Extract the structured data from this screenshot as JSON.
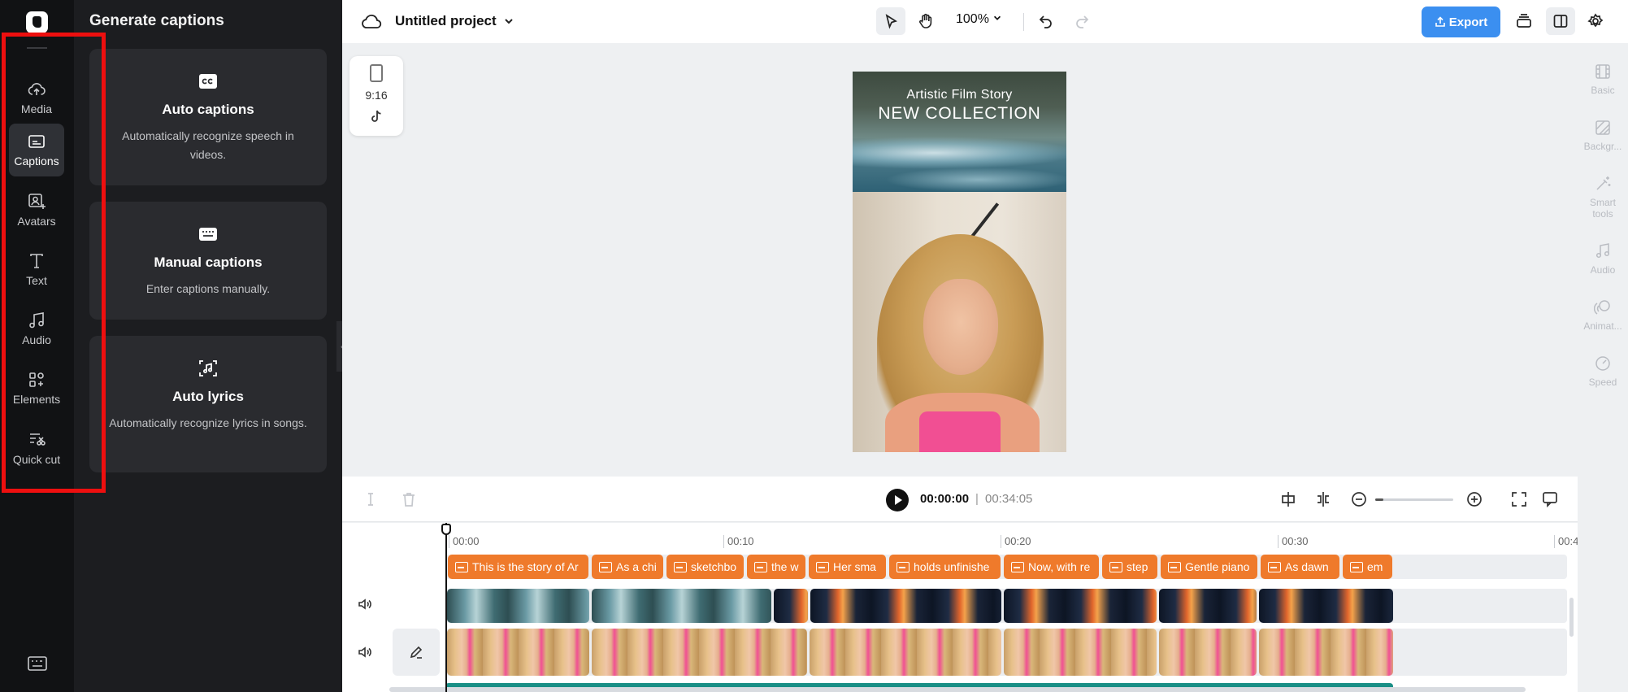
{
  "sidebar": {
    "items": [
      {
        "label": "Media",
        "icon": "cloud-upload-icon"
      },
      {
        "label": "Captions",
        "icon": "captions-icon",
        "active": true
      },
      {
        "label": "Avatars",
        "icon": "avatar-icon"
      },
      {
        "label": "Text",
        "icon": "text-icon"
      },
      {
        "label": "Audio",
        "icon": "music-note-icon"
      },
      {
        "label": "Elements",
        "icon": "elements-icon"
      },
      {
        "label": "Quick cut",
        "icon": "quick-cut-icon"
      }
    ]
  },
  "panel": {
    "title": "Generate captions",
    "cards": [
      {
        "title": "Auto captions",
        "desc": "Automatically recognize speech in videos.",
        "icon": "cc-icon"
      },
      {
        "title": "Manual captions",
        "desc": "Enter captions manually.",
        "icon": "keyboard-icon"
      },
      {
        "title": "Auto lyrics",
        "desc": "Automatically recognize lyrics in songs.",
        "icon": "lyrics-icon"
      }
    ]
  },
  "topbar": {
    "project_name": "Untitled project",
    "zoom": "100%",
    "export_label": "Export",
    "accent": "#3b8ff0"
  },
  "canvas": {
    "aspect_ratio": "9:16",
    "overlay_line1": "Artistic Film Story",
    "overlay_line2": "NEW COLLECTION"
  },
  "right_panel": {
    "items": [
      "Basic",
      "Backgr...",
      "Smart tools",
      "Audio",
      "Animat...",
      "Speed"
    ]
  },
  "playback": {
    "current": "00:00:00",
    "separator": "|",
    "total": "00:34:05",
    "zoom_fraction": 0.1
  },
  "timeline": {
    "ticks": [
      "00:00",
      "00:10",
      "00:20",
      "00:30",
      "00:4"
    ],
    "captions": [
      "This is the story of Ar",
      "As a chi",
      "sketchbo",
      "the w",
      "Her sma",
      "holds unfinishe",
      "Now, with re",
      "step",
      "Gentle piano",
      "As dawn",
      "em"
    ],
    "caption_color": "#ef7a2b"
  }
}
